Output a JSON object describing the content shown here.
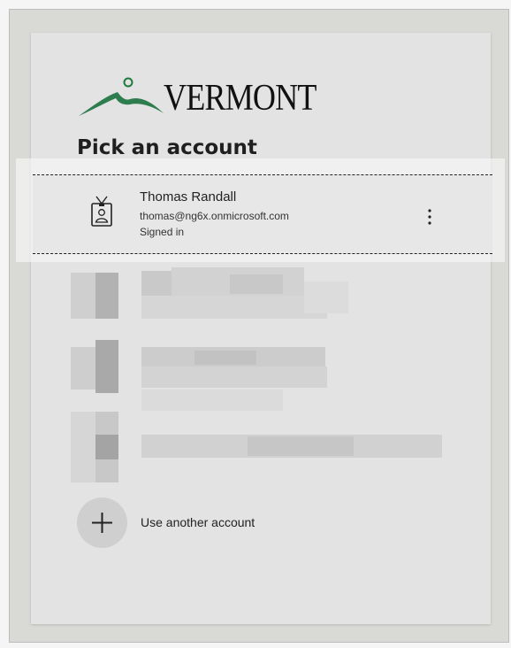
{
  "brand": {
    "logo_text": "VERMONT",
    "accent_color": "#2e7d4f"
  },
  "page_title": "Pick an account",
  "selected_account": {
    "name": "Thomas Randall",
    "email": "thomas@ng6x.onmicrosoft.com",
    "status": "Signed in",
    "icon": "badge-icon",
    "more_icon": "more-options-icon"
  },
  "obscured_accounts_count": 3,
  "use_another_account": {
    "label": "Use another account",
    "icon": "plus-icon"
  }
}
